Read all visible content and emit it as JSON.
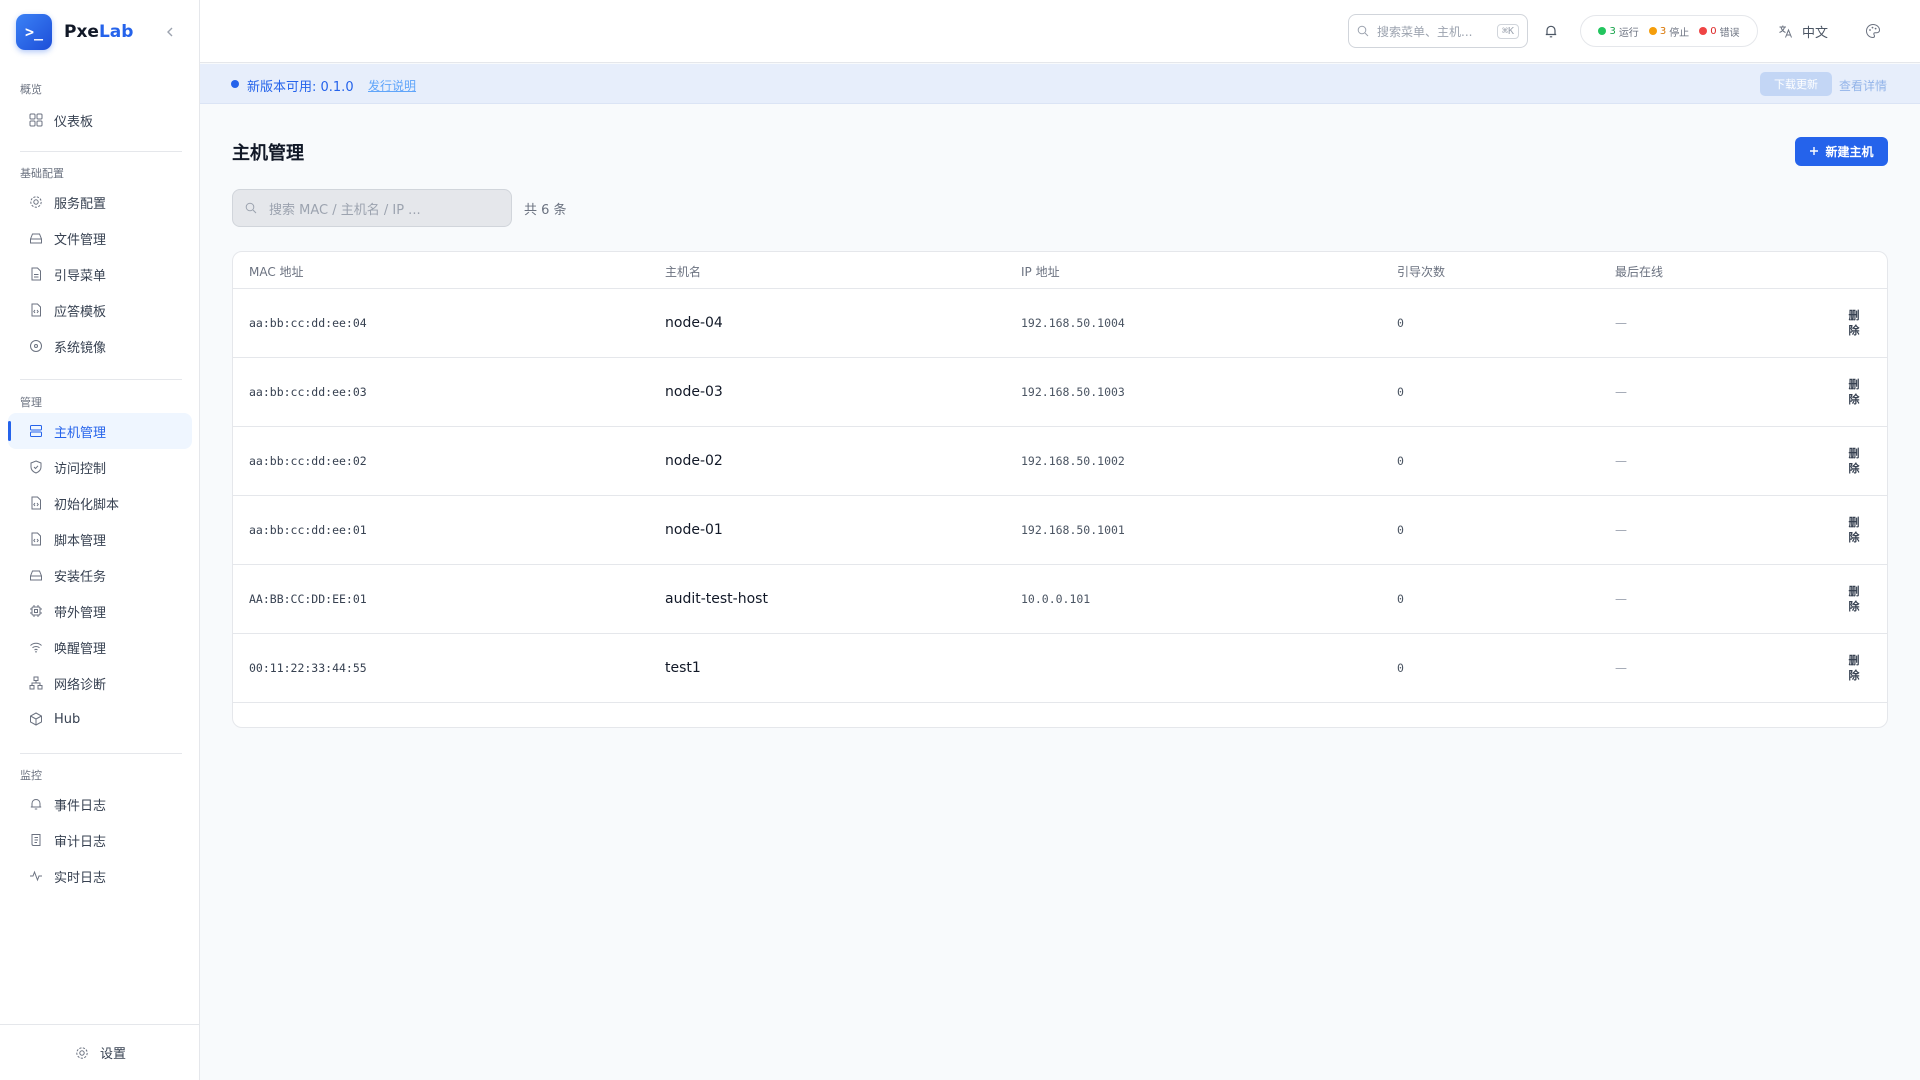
{
  "brand": {
    "logo_glyph": ">_",
    "name_a": "Pxe",
    "name_b": "Lab"
  },
  "header": {
    "search_placeholder": "搜索菜单、主机...",
    "shortcut": "⌘K",
    "status": {
      "running_count": "3",
      "running_label": "运行",
      "stopped_count": "3",
      "stopped_label": "停止",
      "error_count": "0",
      "error_label": "错误"
    },
    "status_colors": {
      "running": "#22c55e",
      "stopped": "#f59e0b",
      "error": "#ef4444"
    },
    "language": "中文"
  },
  "sidebar": {
    "groups": [
      {
        "title": "概览",
        "items": [
          {
            "label": "仪表板",
            "icon": "dashboard-icon"
          }
        ]
      },
      {
        "title": "基础配置",
        "items": [
          {
            "label": "服务配置",
            "icon": "gear-icon"
          },
          {
            "label": "文件管理",
            "icon": "drive-icon"
          },
          {
            "label": "引导菜单",
            "icon": "file-icon"
          },
          {
            "label": "应答模板",
            "icon": "file-code-icon"
          },
          {
            "label": "系统镜像",
            "icon": "disc-icon"
          }
        ]
      },
      {
        "title": "管理",
        "items": [
          {
            "label": "主机管理",
            "icon": "server-icon",
            "active": true
          },
          {
            "label": "访问控制",
            "icon": "shield-icon"
          },
          {
            "label": "初始化脚本",
            "icon": "file-code-icon"
          },
          {
            "label": "脚本管理",
            "icon": "file-code-icon"
          },
          {
            "label": "安装任务",
            "icon": "drive-icon"
          },
          {
            "label": "带外管理",
            "icon": "chip-icon"
          },
          {
            "label": "唤醒管理",
            "icon": "wifi-icon"
          },
          {
            "label": "网络诊断",
            "icon": "network-icon"
          },
          {
            "label": "Hub",
            "icon": "box-icon"
          }
        ]
      },
      {
        "title": "监控",
        "items": [
          {
            "label": "事件日志",
            "icon": "bell-icon"
          },
          {
            "label": "审计日志",
            "icon": "scroll-icon"
          },
          {
            "label": "实时日志",
            "icon": "activity-icon"
          }
        ]
      }
    ],
    "footer_label": "设置"
  },
  "banner": {
    "text": "新版本可用: 0.1.0",
    "link": "发行说明",
    "download": "下载更新",
    "details": "查看详情"
  },
  "main": {
    "title": "主机管理",
    "new_button": "新建主机",
    "search_placeholder": "搜索 MAC / 主机名 / IP ...",
    "total": "共 6 条",
    "columns": [
      "MAC 地址",
      "主机名",
      "IP 地址",
      "引导次数",
      "最后在线"
    ],
    "rows": [
      {
        "mac": "aa:bb:cc:dd:ee:04",
        "hostname": "node-04",
        "ip": "192.168.50.1004",
        "boots": "0",
        "last_seen": "—",
        "action": "删除"
      },
      {
        "mac": "aa:bb:cc:dd:ee:03",
        "hostname": "node-03",
        "ip": "192.168.50.1003",
        "boots": "0",
        "last_seen": "—",
        "action": "删除"
      },
      {
        "mac": "aa:bb:cc:dd:ee:02",
        "hostname": "node-02",
        "ip": "192.168.50.1002",
        "boots": "0",
        "last_seen": "—",
        "action": "删除"
      },
      {
        "mac": "aa:bb:cc:dd:ee:01",
        "hostname": "node-01",
        "ip": "192.168.50.1001",
        "boots": "0",
        "last_seen": "—",
        "action": "删除"
      },
      {
        "mac": "AA:BB:CC:DD:EE:01",
        "hostname": "audit-test-host",
        "ip": "10.0.0.101",
        "boots": "0",
        "last_seen": "—",
        "action": "删除"
      },
      {
        "mac": "00:11:22:33:44:55",
        "hostname": "test1",
        "ip": "",
        "boots": "0",
        "last_seen": "—",
        "action": "删除"
      }
    ]
  }
}
